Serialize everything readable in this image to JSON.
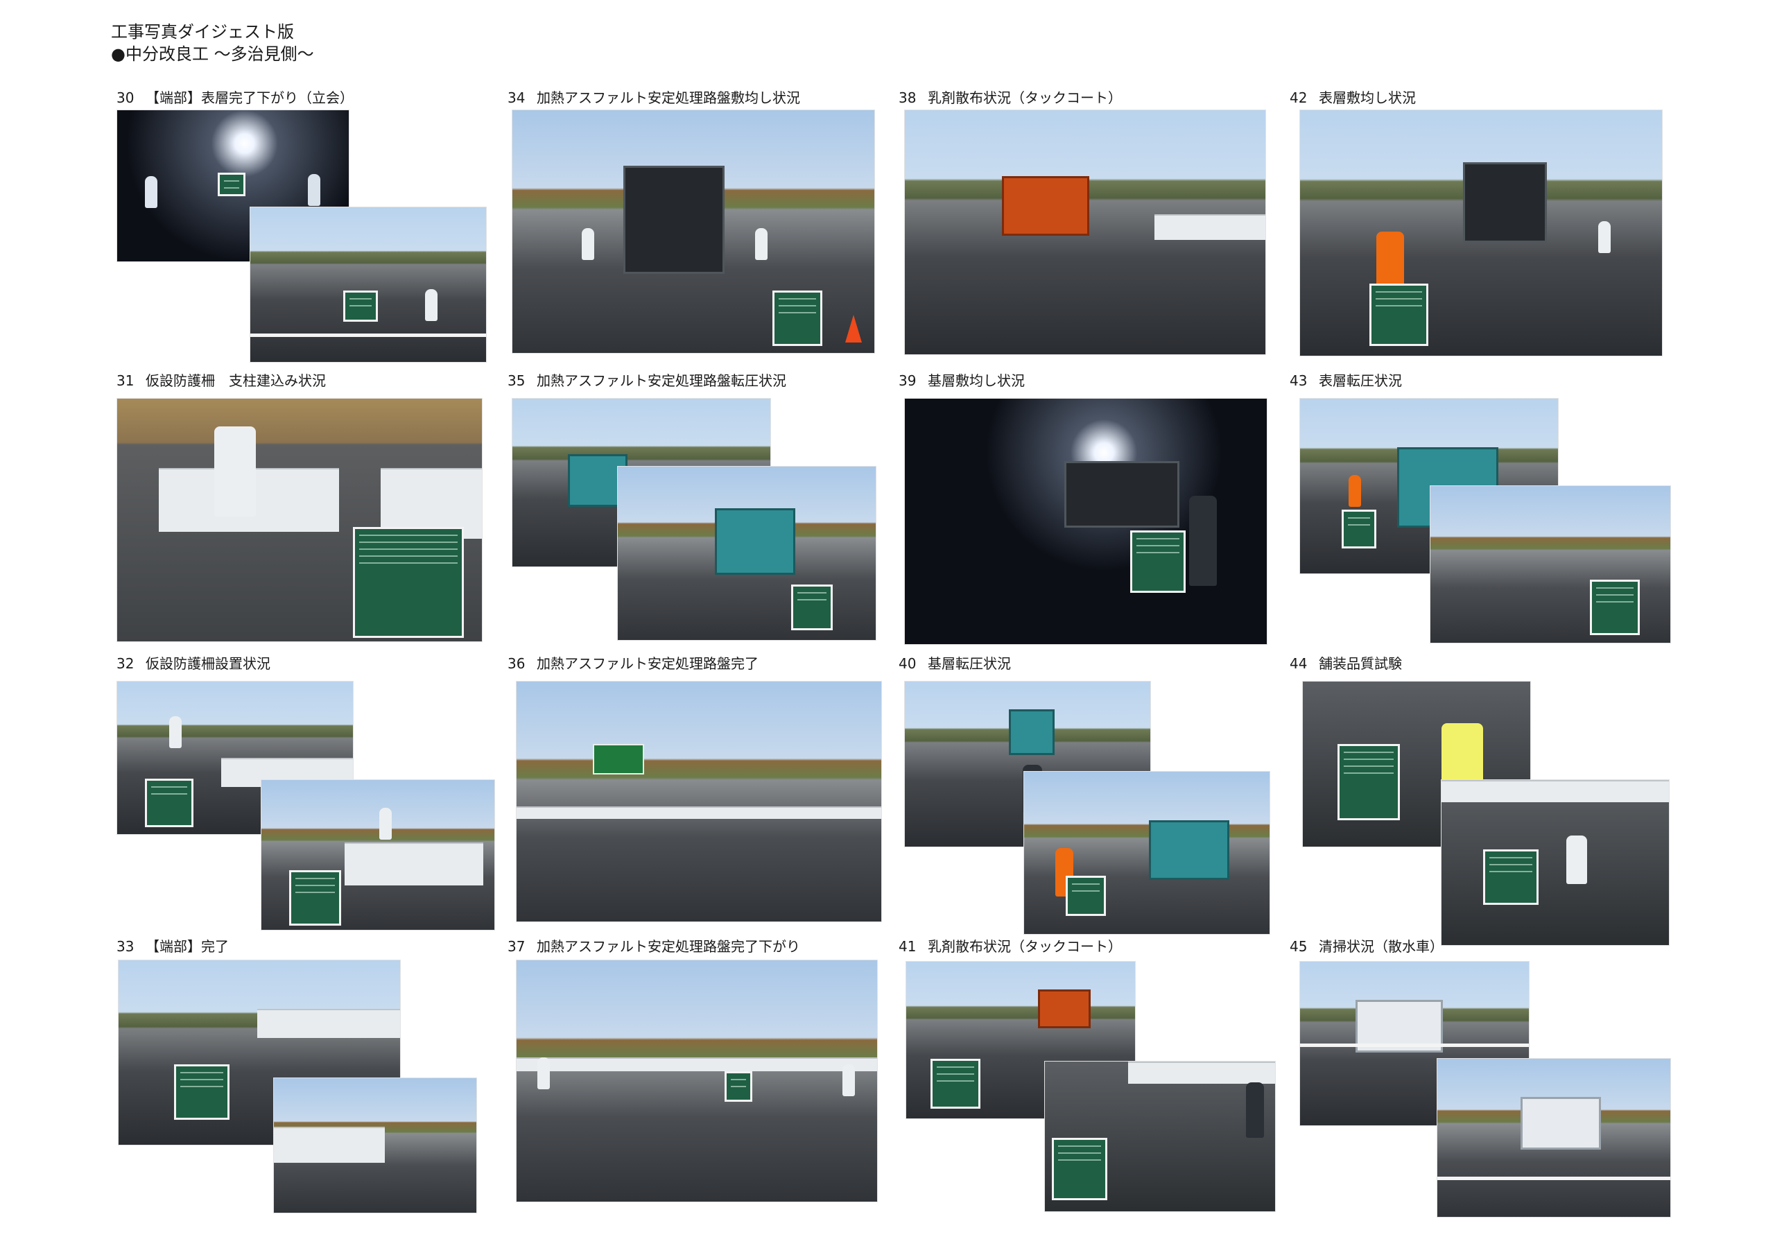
{
  "header": {
    "title": "工事写真ダイジェスト版",
    "subtitle": "●中分改良工 ～多治見側～"
  },
  "photos": [
    {
      "num": "30",
      "caption": "【端部】表層完了下がり（立会）"
    },
    {
      "num": "34",
      "caption": "加熱アスファルト安定処理路盤敷均し状況"
    },
    {
      "num": "38",
      "caption": "乳剤散布状況（タックコート）"
    },
    {
      "num": "42",
      "caption": "表層敷均し状況"
    },
    {
      "num": "31",
      "caption": "仮設防護柵　支柱建込み状況"
    },
    {
      "num": "35",
      "caption": "加熱アスファルト安定処理路盤転圧状況"
    },
    {
      "num": "39",
      "caption": "基層敷均し状況"
    },
    {
      "num": "43",
      "caption": "表層転圧状況"
    },
    {
      "num": "32",
      "caption": "仮設防護柵設置状況"
    },
    {
      "num": "36",
      "caption": "加熱アスファルト安定処理路盤完了"
    },
    {
      "num": "40",
      "caption": "基層転圧状況"
    },
    {
      "num": "44",
      "caption": "舗装品質試験"
    },
    {
      "num": "33",
      "caption": "【端部】完了"
    },
    {
      "num": "37",
      "caption": "加熱アスファルト安定処理路盤完了下がり"
    },
    {
      "num": "41",
      "caption": "乳剤散布状況（タックコート）"
    },
    {
      "num": "45",
      "caption": "清掃状況（散水車）"
    }
  ]
}
